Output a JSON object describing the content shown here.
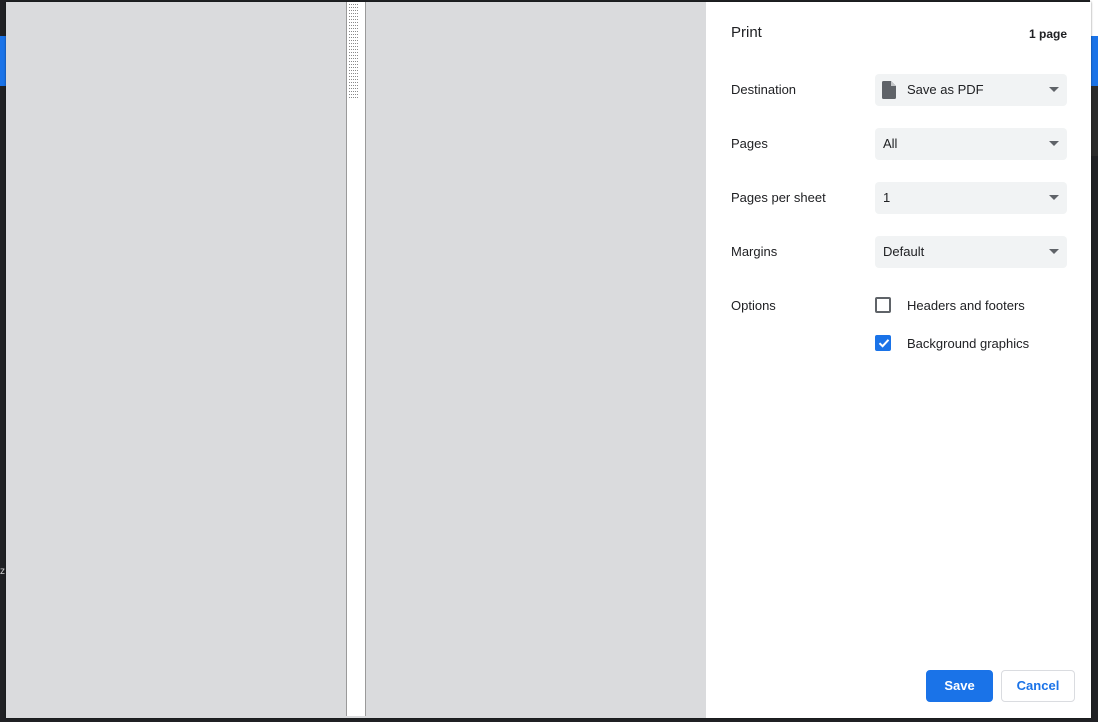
{
  "dialog": {
    "title": "Print",
    "page_count": "1 page"
  },
  "settings": {
    "destination": {
      "label": "Destination",
      "value": "Save as PDF",
      "icon": "document-icon"
    },
    "pages": {
      "label": "Pages",
      "value": "All"
    },
    "pages_per_sheet": {
      "label": "Pages per sheet",
      "value": "1"
    },
    "margins": {
      "label": "Margins",
      "value": "Default"
    },
    "options": {
      "label": "Options",
      "headers_footers": {
        "label": "Headers and footers",
        "checked": false
      },
      "background_graphics": {
        "label": "Background graphics",
        "checked": true
      }
    }
  },
  "buttons": {
    "save": "Save",
    "cancel": "Cancel"
  },
  "colors": {
    "accent": "#1a73e8",
    "preview_bg": "#dadbdd",
    "select_bg": "#f1f3f4"
  },
  "background_app": {
    "edge_glyph": "z"
  }
}
